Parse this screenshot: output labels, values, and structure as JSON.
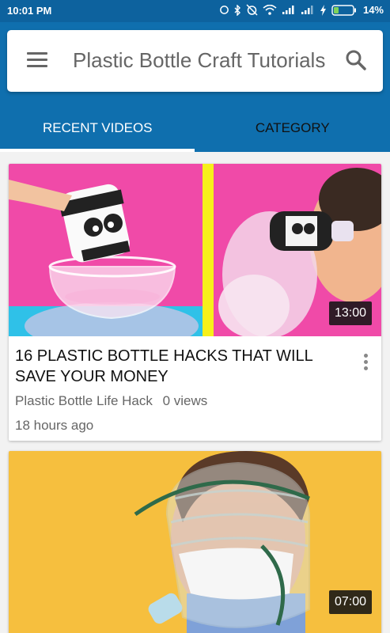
{
  "status_bar": {
    "time": "10:01 PM",
    "battery": "14%",
    "icons": [
      "sync-icon",
      "bluetooth-icon",
      "alarm-off-icon",
      "wifi-icon",
      "signal-icon",
      "signal-icon",
      "charging-icon",
      "battery-icon"
    ]
  },
  "app_bar": {
    "title": "Plastic Bottle Craft Tutorials",
    "menu_icon": "menu-icon",
    "search_icon": "search-icon",
    "background": "#0f6fae"
  },
  "tabs": [
    {
      "label": "RECENT VIDEOS",
      "selected": true
    },
    {
      "label": "CATEGORY",
      "selected": false
    }
  ],
  "videos": [
    {
      "title": "16 PLASTIC BOTTLE HACKS THAT WILL SAVE YOUR MONEY",
      "channel": "Plastic Bottle Life Hack",
      "views": "0 views",
      "time_ago": "18 hours ago",
      "duration": "13:00"
    },
    {
      "title": "",
      "duration": "07:00"
    }
  ]
}
